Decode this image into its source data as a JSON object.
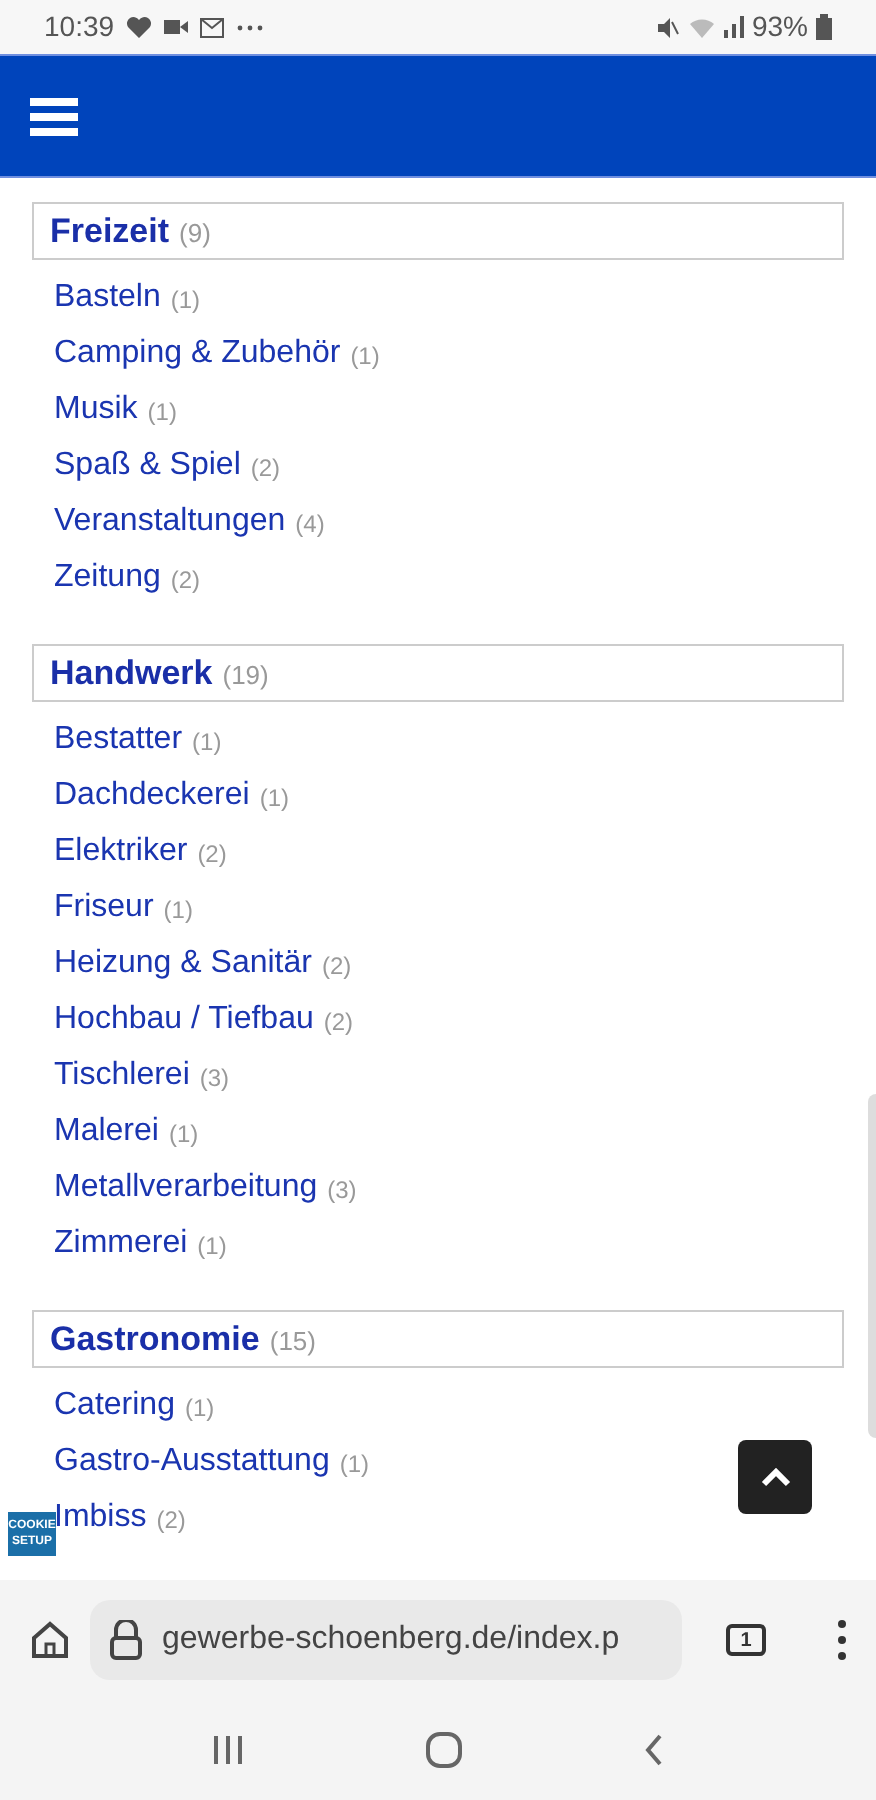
{
  "status_bar": {
    "time": "10:39",
    "battery": "93%"
  },
  "sections": [
    {
      "title": "Freizeit",
      "count": "(9)",
      "items": [
        {
          "label": "Basteln",
          "count": "(1)"
        },
        {
          "label": "Camping & Zubehör",
          "count": "(1)"
        },
        {
          "label": "Musik",
          "count": "(1)"
        },
        {
          "label": "Spaß & Spiel",
          "count": "(2)"
        },
        {
          "label": "Veranstaltungen",
          "count": "(4)"
        },
        {
          "label": "Zeitung",
          "count": "(2)"
        }
      ]
    },
    {
      "title": "Handwerk",
      "count": "(19)",
      "items": [
        {
          "label": "Bestatter",
          "count": "(1)"
        },
        {
          "label": "Dachdeckerei",
          "count": "(1)"
        },
        {
          "label": "Elektriker",
          "count": "(2)"
        },
        {
          "label": "Friseur",
          "count": "(1)"
        },
        {
          "label": "Heizung & Sanitär",
          "count": "(2)"
        },
        {
          "label": "Hochbau / Tiefbau",
          "count": "(2)"
        },
        {
          "label": "Tischlerei",
          "count": "(3)"
        },
        {
          "label": "Malerei",
          "count": "(1)"
        },
        {
          "label": "Metallverarbeitung",
          "count": "(3)"
        },
        {
          "label": "Zimmerei",
          "count": "(1)"
        }
      ]
    },
    {
      "title": "Gastronomie",
      "count": "(15)",
      "items": [
        {
          "label": "Catering",
          "count": "(1)"
        },
        {
          "label": "Gastro-Ausstattung",
          "count": "(1)"
        },
        {
          "label": "Imbiss",
          "count": "(2)"
        }
      ]
    }
  ],
  "cookie_badge": [
    "COOKIE",
    "SETUP"
  ],
  "browser": {
    "url": "gewerbe-schoenberg.de/index.p",
    "tabs_count": "1"
  }
}
